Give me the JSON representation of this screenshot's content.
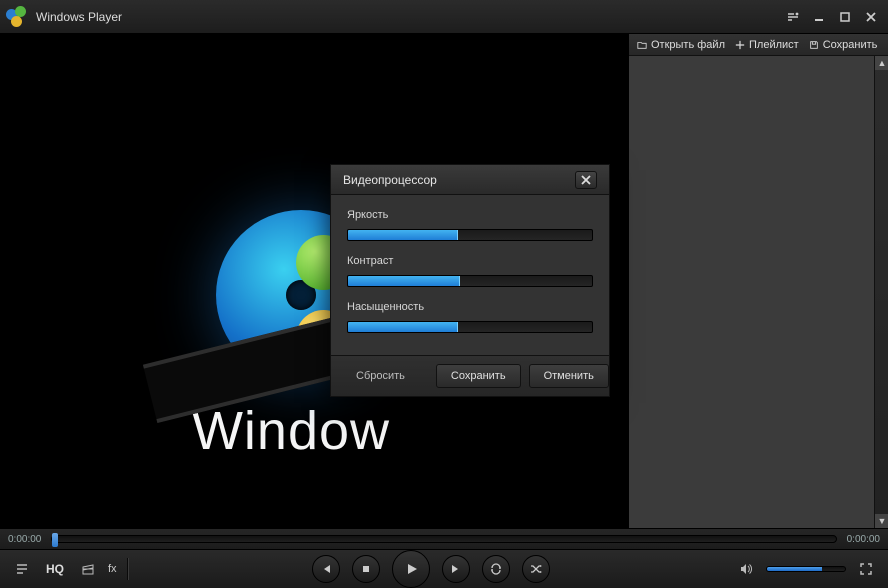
{
  "title": "Windows Player",
  "logo_text": "Window",
  "sidebar": {
    "open_file": "Открыть файл",
    "playlist": "Плейлист",
    "save": "Сохранить"
  },
  "seek": {
    "current": "0:00:00",
    "total": "0:00:00",
    "position_pct": 0
  },
  "controls": {
    "hq": "HQ",
    "fx": "fx"
  },
  "volume_pct": 70,
  "dialog": {
    "title": "Видеопроцессор",
    "brightness": {
      "label": "Яркость",
      "value_pct": 45
    },
    "contrast": {
      "label": "Контраст",
      "value_pct": 46
    },
    "saturation": {
      "label": "Насыщенность",
      "value_pct": 45
    },
    "reset": "Сбросить",
    "save": "Сохранить",
    "cancel": "Отменить"
  }
}
